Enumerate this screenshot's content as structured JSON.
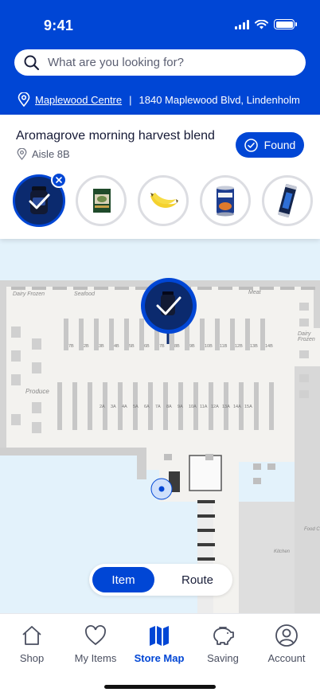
{
  "status_bar": {
    "time": "9:41"
  },
  "search": {
    "placeholder": "What are you looking for?"
  },
  "location": {
    "store_name": "Maplewood Centre",
    "separator": "|",
    "address": "1840 Maplewood Blvd, Lindenholm"
  },
  "product": {
    "name": "Aromagrove morning harvest blend",
    "aisle": "Aisle 8B",
    "found_label": "Found"
  },
  "shopping_items": [
    {
      "name": "coffee-jar",
      "status": "found-selected"
    },
    {
      "name": "tea-box",
      "status": "pending"
    },
    {
      "name": "bananas",
      "status": "pending"
    },
    {
      "name": "canned-soup",
      "status": "pending"
    },
    {
      "name": "chocolate-bar",
      "status": "pending"
    }
  ],
  "map": {
    "department_labels": [
      "Dairy Frozen",
      "Seafood",
      "Meat",
      "Dairy Frozen",
      "Produce",
      "Food C",
      "Kitchen"
    ],
    "aisle_labels_top": [
      "7B",
      "2B",
      "3B",
      "4B",
      "5B",
      "6B",
      "7B",
      "8B",
      "9B",
      "10B",
      "11B",
      "12B",
      "13B",
      "14B"
    ],
    "aisle_labels_bottom": [
      "2A",
      "3A",
      "4A",
      "5A",
      "6A",
      "7A",
      "8A",
      "9A",
      "10A",
      "11A",
      "12A",
      "13A",
      "14A",
      "15A"
    ]
  },
  "view_toggle": {
    "item_label": "Item",
    "route_label": "Route",
    "active": "Item"
  },
  "bottom_nav": [
    {
      "label": "Shop",
      "icon": "house-icon"
    },
    {
      "label": "My Items",
      "icon": "heart-icon"
    },
    {
      "label": "Store Map",
      "icon": "map-icon",
      "active": true
    },
    {
      "label": "Saving",
      "icon": "piggy-bank-icon"
    },
    {
      "label": "Account",
      "icon": "account-icon"
    }
  ],
  "colors": {
    "brand_blue": "#0046d5",
    "selected_dark": "#0b2a6e",
    "map_water": "#e3f2fb",
    "map_floor": "#f3f2ef",
    "shelf": "#c9c9c9"
  }
}
